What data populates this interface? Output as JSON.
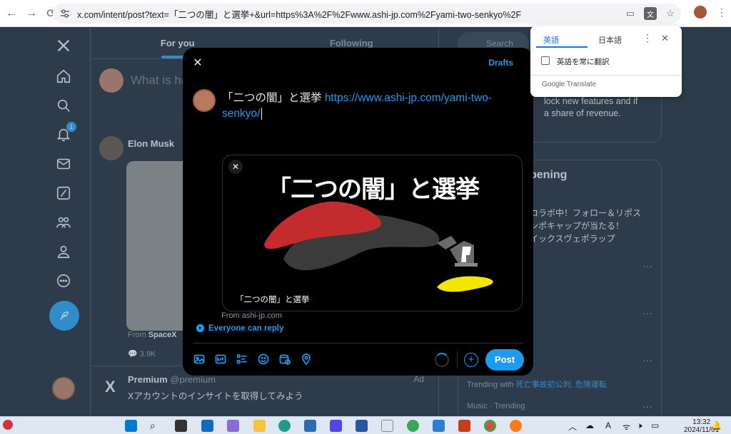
{
  "browser": {
    "url": "x.com/intent/post?text=「二つの闇」と選挙+&url=https%3A%2F%2Fwww.ashi-jp.com%2Fyami-two-senkyo%2F"
  },
  "timeline": {
    "tabs": [
      {
        "label": "For you"
      },
      {
        "label": "Following"
      }
    ],
    "compose_placeholder": "What is ha",
    "notification_count": "1",
    "elon_name": "Elon Musk",
    "from_label": "From",
    "from_source": "SpaceX",
    "views": "3.9K",
    "premium_name": "Premium",
    "premium_handle": "@premium",
    "premium_ad": "Ad",
    "premium_text": "Xアカウントのインサイトを取得してみよう"
  },
  "right": {
    "search_placeholder": "Search",
    "card1_line1": "lock new features and if",
    "card1_line2": "a share of revenue.",
    "happening_title": "pening",
    "line_a": "コラボ中！フォロー＆リポス",
    "line_b": "ンポキャップが当たる！",
    "line_c": "イックスヴェポラップ",
    "trend_meta_prefix": "Trending with",
    "trend_links": "死亡事故初公判, 危険運転",
    "trend2": "Music · Trending"
  },
  "modal": {
    "drafts": "Drafts",
    "text_plain": "「二つの闇」と選挙 ",
    "text_link": "https://www.ashi-jp.com/yami-two-senkyo/",
    "card_title": "「二つの闇」と選挙",
    "card_caption": "「二つの闇」と選挙",
    "from_site": "From ashi-jp.com",
    "reply_setting": "Everyone can reply",
    "post_label": "Post"
  },
  "translate": {
    "tab_source": "英語",
    "tab_target": "日本語",
    "always_translate": "英語を常に翻訳",
    "brand": "Google Translate"
  },
  "taskbar": {
    "time": "13:32",
    "date": "2024/11/01"
  },
  "colors": {
    "accent": "#1d9bf0",
    "background": "#15202b",
    "modal_bg": "#000000"
  }
}
